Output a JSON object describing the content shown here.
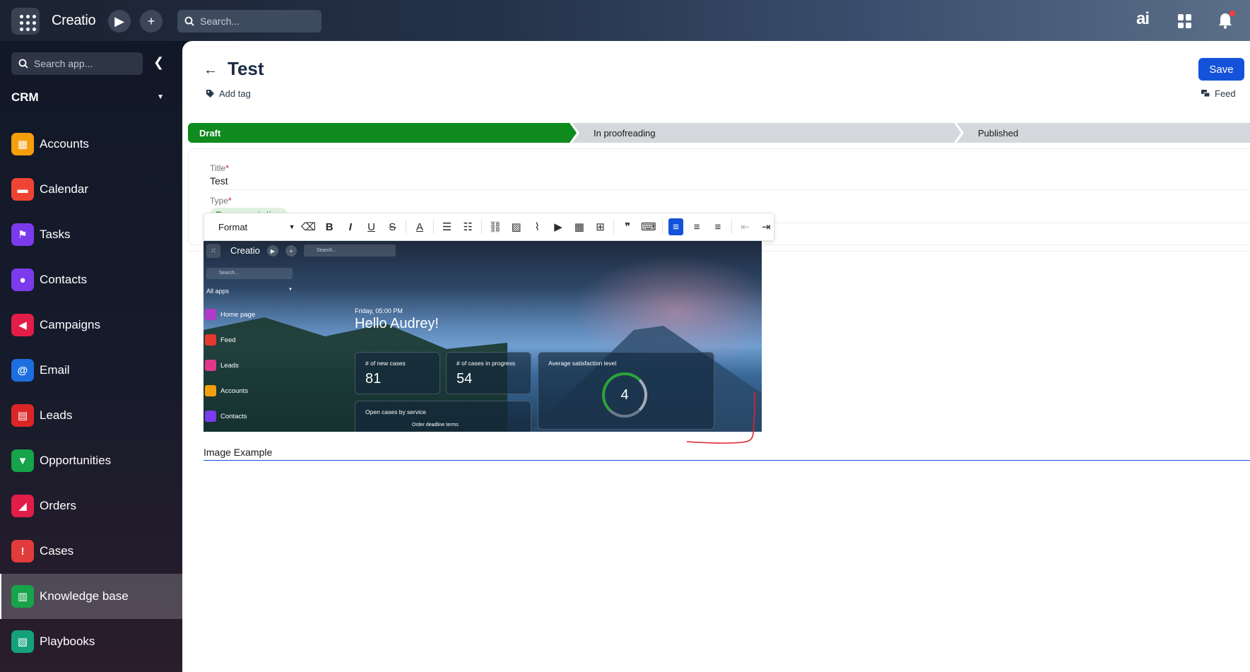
{
  "topbar": {
    "logo": "Creatio",
    "search_placeholder": "Search...",
    "ai_label": "ai"
  },
  "sidebar": {
    "search_placeholder": "Search app...",
    "workspace": "CRM",
    "items": [
      {
        "label": "Accounts",
        "color": "#f59e0b",
        "icon": "building-icon"
      },
      {
        "label": "Calendar",
        "color": "#ef4433",
        "icon": "calendar-icon"
      },
      {
        "label": "Tasks",
        "color": "#7c3aed",
        "icon": "flag-icon"
      },
      {
        "label": "Contacts",
        "color": "#7c3aed",
        "icon": "person-icon"
      },
      {
        "label": "Campaigns",
        "color": "#e11d48",
        "icon": "megaphone-icon"
      },
      {
        "label": "Email",
        "color": "#1d6fe0",
        "icon": "at-icon"
      },
      {
        "label": "Leads",
        "color": "#dc2626",
        "icon": "leads-icon"
      },
      {
        "label": "Opportunities",
        "color": "#16a34a",
        "icon": "funnel-icon"
      },
      {
        "label": "Orders",
        "color": "#e11d48",
        "icon": "cart-icon"
      },
      {
        "label": "Cases",
        "color": "#e23b3b",
        "icon": "case-icon"
      },
      {
        "label": "Knowledge base",
        "color": "#16a34a",
        "icon": "book-icon",
        "active": true
      },
      {
        "label": "Playbooks",
        "color": "#15a27b",
        "icon": "playbook-icon"
      }
    ]
  },
  "page": {
    "title": "Test",
    "add_tag": "Add tag",
    "save_label": "Save",
    "feed_label": "Feed"
  },
  "stages": {
    "s1": "Draft",
    "s2": "In proofreading",
    "s3": "Published"
  },
  "form": {
    "title_label": "Title",
    "title_value": "Test",
    "type_label": "Type",
    "type_value": "Documentation"
  },
  "editor": {
    "format_label": "Format",
    "caption": "Image Example"
  },
  "embedded": {
    "logo": "Creatio",
    "search": "Search...",
    "side_search": "Search...",
    "all_apps": "All apps",
    "nav": [
      "Home page",
      "Feed",
      "Leads",
      "Accounts",
      "Contacts"
    ],
    "greeting_time": "Friday, 05:00 PM",
    "greeting": "Hello Audrey!",
    "card_new_label": "# of new cases",
    "card_new_value": "81",
    "card_progress_label": "# of cases in progress",
    "card_progress_value": "54",
    "card_satisfaction_label": "Average satisfaction level",
    "card_satisfaction_value": "4",
    "card_open_label": "Open cases by service",
    "card_open_sub": "Order deadline terms"
  }
}
